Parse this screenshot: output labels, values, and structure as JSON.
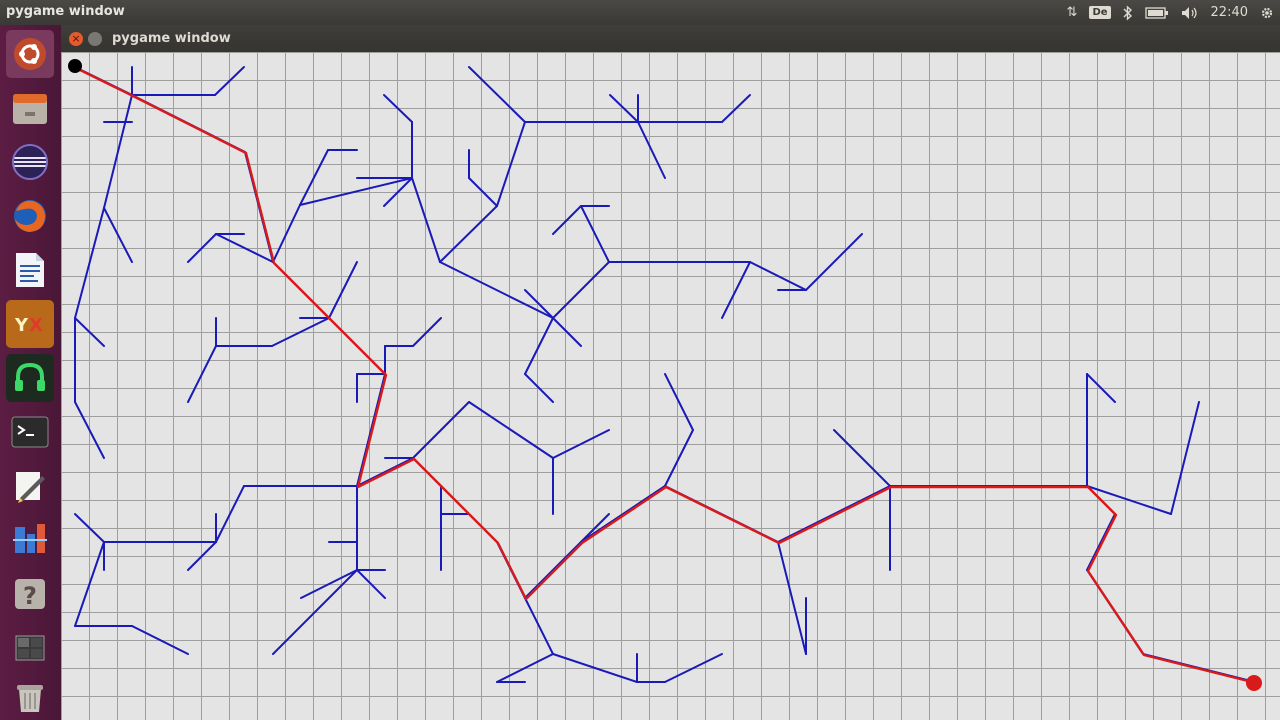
{
  "topbar": {
    "app_title": "pygame window",
    "keyboard_layout": "De",
    "clock": "22:40",
    "icons": [
      "network-arrows-icon",
      "keyboard-layout-indicator",
      "bluetooth-icon",
      "battery-icon",
      "volume-icon",
      "gear-icon"
    ]
  },
  "launcher": {
    "items": [
      "ubuntu-dash-icon",
      "files-icon",
      "eclipse-icon",
      "firefox-icon",
      "libreoffice-writer-icon",
      "yx-app-icon",
      "headphones-app-icon",
      "terminal-icon",
      "text-editor-icon",
      "system-monitor-icon",
      "help-icon",
      "workspace-switcher-icon",
      "trash-icon"
    ]
  },
  "window": {
    "title": "pygame window"
  },
  "colors": {
    "tree": "#1a1ab8",
    "path": "#d91a1a",
    "grid": "#9e9e9e",
    "start": "#000000",
    "goal": "#d91a1a"
  }
}
